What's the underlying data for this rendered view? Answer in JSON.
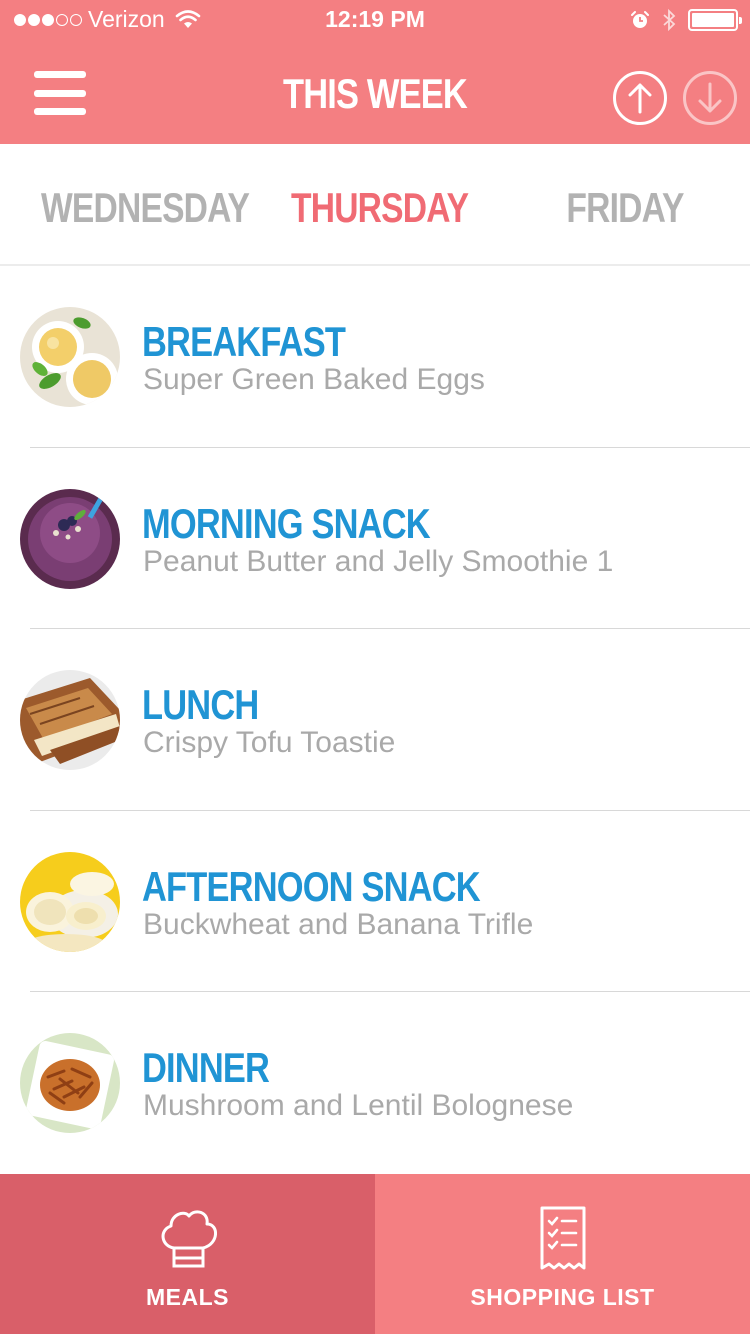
{
  "status_bar": {
    "carrier": "Verizon",
    "time": "12:19 PM",
    "signal_bars_filled": 3,
    "signal_bars_total": 5
  },
  "header": {
    "title": "THIS WEEK",
    "menu_icon": "hamburger-menu-icon",
    "up_icon": "arrow-up-circle-icon",
    "down_icon": "arrow-down-circle-icon"
  },
  "days": {
    "previous": "WEDNESDAY",
    "current": "THURSDAY",
    "next": "FRIDAY"
  },
  "meals": [
    {
      "name": "BREAKFAST",
      "recipe": "Super Green Baked Eggs"
    },
    {
      "name": "MORNING SNACK",
      "recipe": "Peanut Butter and Jelly Smoothie 1"
    },
    {
      "name": "LUNCH",
      "recipe": "Crispy Tofu Toastie"
    },
    {
      "name": "AFTERNOON SNACK",
      "recipe": "Buckwheat and Banana Trifle"
    },
    {
      "name": "DINNER",
      "recipe": "Mushroom and Lentil Bolognese"
    }
  ],
  "tabs": [
    {
      "label": "MEALS",
      "icon": "chef-hat-icon",
      "active": true
    },
    {
      "label": "SHOPPING LIST",
      "icon": "checklist-receipt-icon",
      "active": false
    }
  ],
  "colors": {
    "header": "#f47f82",
    "active_tab": "#d95f69",
    "current_day": "#f06b74",
    "meal_name": "#2094d4",
    "inactive_day": "#b2b2b2",
    "recipe_text": "#a9a9a9"
  }
}
